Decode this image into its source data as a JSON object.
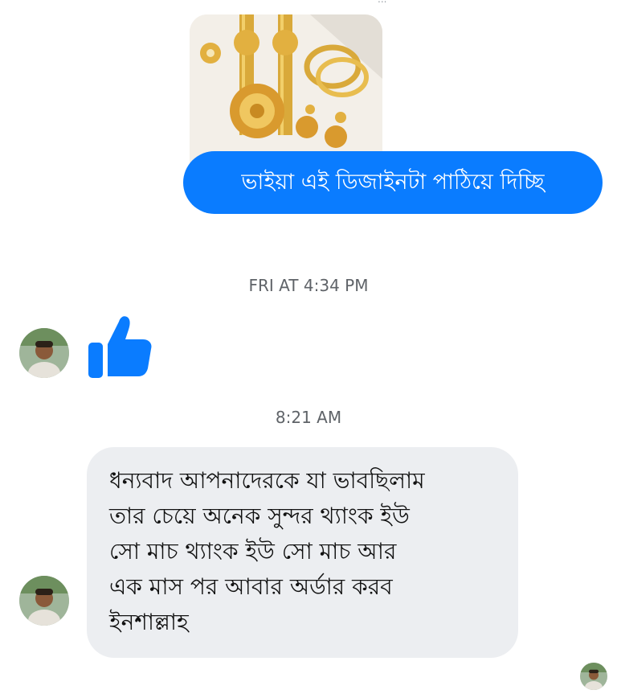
{
  "conversation": {
    "top_partial_text": "...",
    "outgoing_photo": {
      "icon": "jewelry-photo"
    },
    "outgoing_message": "ভাইয়া এই ডিজাইনটা পাঠিয়ে দিচ্ছি",
    "timestamp_1": "FRI AT 4:34 PM",
    "reaction_icon": "thumbs-up-icon",
    "timestamp_2": "8:21 AM",
    "incoming_message_lines": [
      "ধন্যবাদ আপনাদেরকে যা ভাবছিলাম",
      "তার চেয়ে অনেক সুন্দর থ্যাংক ইউ",
      "সো মাচ থ্যাংক ইউ সো মাচ আর",
      "এক মাস পর আবার অর্ডার করব",
      "ইনশাল্লাহ"
    ]
  },
  "colors": {
    "outgoing_bubble": "#0a7cff",
    "incoming_bubble": "#eceef1",
    "like_blue": "#0a7cff",
    "timestamp": "#5f6368"
  }
}
